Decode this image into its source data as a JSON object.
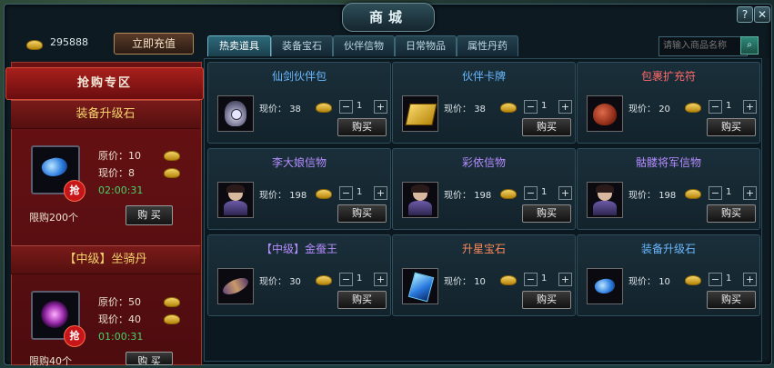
{
  "window": {
    "title": "商城",
    "help_label": "?",
    "close_label": "✕"
  },
  "gold": {
    "value": "295888",
    "recharge_label": "立即充值"
  },
  "left_panel": {
    "banner": "抢购专区",
    "items": [
      {
        "title": "装备升级石",
        "original_label": "原价：10",
        "current_label": "现价：8",
        "timer": "02:00:31",
        "limit": "限购200个",
        "buy_label": "购 买",
        "badge": "抢",
        "icon": "blue-gem-icon"
      },
      {
        "title": "【中级】坐骑丹",
        "original_label": "原价：50",
        "current_label": "现价：40",
        "timer": "01:00:31",
        "limit": "限购40个",
        "buy_label": "购 买",
        "badge": "抢",
        "icon": "purple-orb-icon"
      }
    ]
  },
  "tabs": [
    {
      "label": "热卖道具",
      "active": true
    },
    {
      "label": "装备宝石",
      "active": false
    },
    {
      "label": "伙伴信物",
      "active": false
    },
    {
      "label": "日常物品",
      "active": false
    },
    {
      "label": "属性丹药",
      "active": false
    }
  ],
  "search": {
    "placeholder": "请输入商品名称"
  },
  "products": [
    {
      "name": "仙剑伙伴包",
      "name_color": "#6ab8ff",
      "price_label": "现价：",
      "price": "38",
      "qty": "1",
      "buy_label": "购买",
      "icon": "bag-icon"
    },
    {
      "name": "伙伴卡牌",
      "name_color": "#6ab8ff",
      "price_label": "现价：",
      "price": "38",
      "qty": "1",
      "buy_label": "购买",
      "icon": "card-deck-icon"
    },
    {
      "name": "包裹扩充符",
      "name_color": "#ff6a6a",
      "price_label": "现价：",
      "price": "20",
      "qty": "1",
      "buy_label": "购买",
      "icon": "pouch-icon"
    },
    {
      "name": "李大娘信物",
      "name_color": "#b58cff",
      "price_label": "现价：",
      "price": "198",
      "qty": "1",
      "buy_label": "购买",
      "icon": "portrait-icon"
    },
    {
      "name": "彩依信物",
      "name_color": "#b58cff",
      "price_label": "现价：",
      "price": "198",
      "qty": "1",
      "buy_label": "购买",
      "icon": "portrait-icon"
    },
    {
      "name": "骷髅将军信物",
      "name_color": "#b58cff",
      "price_label": "现价：",
      "price": "198",
      "qty": "1",
      "buy_label": "购买",
      "icon": "portrait-icon"
    },
    {
      "name": "【中级】金蚕王",
      "name_color": "#b58cff",
      "price_label": "现价：",
      "price": "30",
      "qty": "1",
      "buy_label": "购买",
      "icon": "silkworm-icon"
    },
    {
      "name": "升星宝石",
      "name_color": "#ff8a5a",
      "price_label": "现价：",
      "price": "10",
      "qty": "1",
      "buy_label": "购买",
      "icon": "blue-crystal-icon"
    },
    {
      "name": "装备升级石",
      "name_color": "#6ab8ff",
      "price_label": "现价：",
      "price": "10",
      "qty": "1",
      "buy_label": "购买",
      "icon": "blue-gem-icon"
    }
  ]
}
